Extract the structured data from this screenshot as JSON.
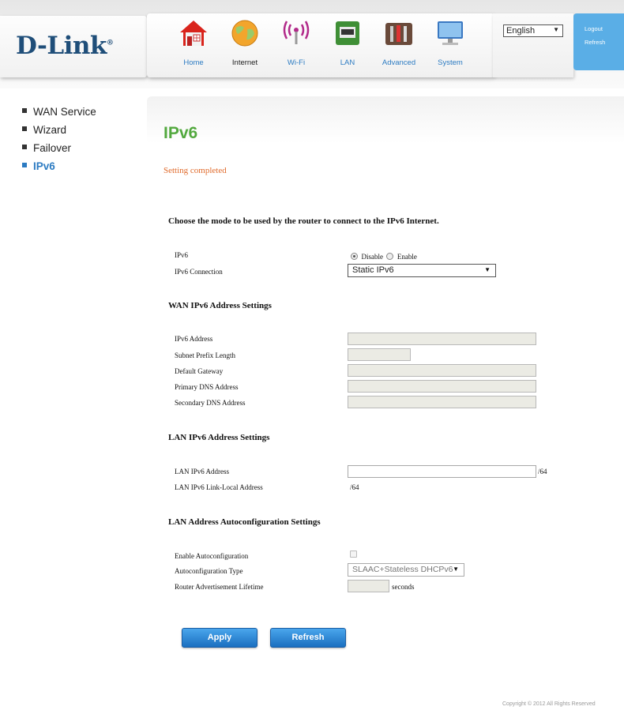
{
  "brand": {
    "logo": "D-Link",
    "registered_mark": "®"
  },
  "nav": [
    {
      "label": "Home",
      "icon": "home-icon",
      "active": false
    },
    {
      "label": "Internet",
      "icon": "globe-icon",
      "active": true
    },
    {
      "label": "Wi-Fi",
      "icon": "wifi-icon",
      "active": false
    },
    {
      "label": "LAN",
      "icon": "lan-port-icon",
      "active": false
    },
    {
      "label": "Advanced",
      "icon": "tools-icon",
      "active": false
    },
    {
      "label": "System",
      "icon": "monitor-icon",
      "active": false
    }
  ],
  "language": {
    "selected": "English"
  },
  "account": {
    "logout": "Logout",
    "refresh": "Refresh"
  },
  "sidebar": {
    "items": [
      {
        "label": "WAN Service",
        "active": false
      },
      {
        "label": "Wizard",
        "active": false
      },
      {
        "label": "Failover",
        "active": false
      },
      {
        "label": "IPv6",
        "active": true
      }
    ]
  },
  "page": {
    "title": "IPv6",
    "status": "Setting completed",
    "intro": "Choose the mode to be used by the router to connect to the IPv6 Internet."
  },
  "mode": {
    "ipv6_label": "IPv6",
    "disable_label": "Disable",
    "enable_label": "Enable",
    "selected": "Disable",
    "connection_label": "IPv6 Connection",
    "connection_value": "Static IPv6"
  },
  "wan": {
    "heading": "WAN IPv6 Address Settings",
    "address_label": "IPv6 Address",
    "address_value": "",
    "prefix_label": "Subnet Prefix Length",
    "prefix_value": "",
    "gateway_label": "Default Gateway",
    "gateway_value": "",
    "primary_dns_label": "Primary DNS Address",
    "primary_dns_value": "",
    "secondary_dns_label": "Secondary DNS Address",
    "secondary_dns_value": ""
  },
  "lan": {
    "heading": "LAN IPv6 Address Settings",
    "address_label": "LAN IPv6 Address",
    "address_value": "",
    "address_suffix": "/64",
    "link_local_label": "LAN IPv6 Link-Local Address",
    "link_local_value": "/64"
  },
  "autoconf": {
    "heading": "LAN Address Autoconfiguration Settings",
    "enable_label": "Enable Autoconfiguration",
    "enabled": false,
    "type_label": "Autoconfiguration Type",
    "type_value": "SLAAC+Stateless DHCPv6",
    "lifetime_label": "Router Advertisement Lifetime",
    "lifetime_value": "",
    "lifetime_unit": "seconds"
  },
  "buttons": {
    "apply": "Apply",
    "refresh": "Refresh"
  },
  "footer": {
    "copyright": "Copyright © 2012  All Rights Reserved"
  },
  "colors": {
    "accent_green": "#53a93f",
    "link_blue": "#2c7bc2",
    "status_orange": "#e06a2b",
    "button_blue": "#1a6fc0"
  }
}
